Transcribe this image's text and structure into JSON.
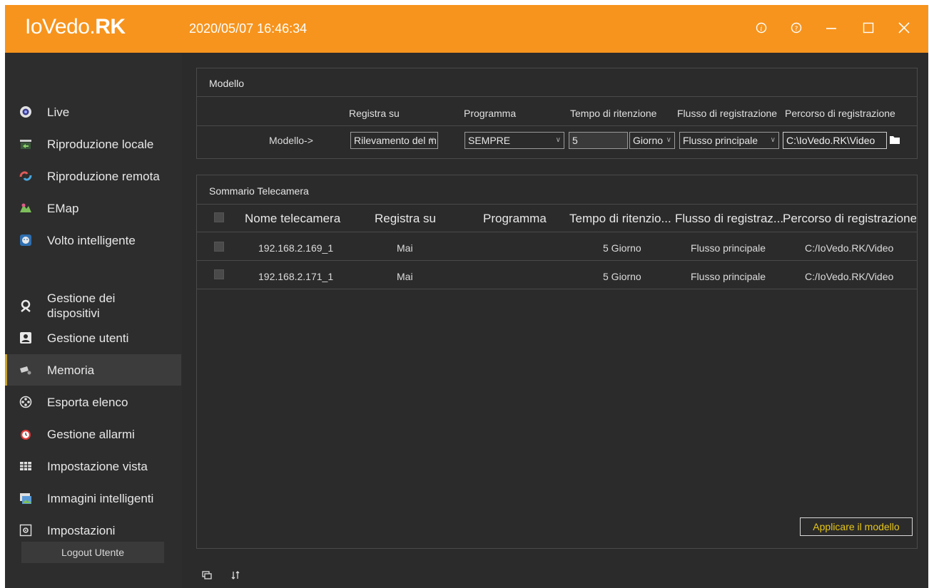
{
  "app": {
    "logo_light": "IoVedo.",
    "logo_bold": "RK",
    "datetime": "2020/05/07 16:46:34"
  },
  "titlebar_icons": [
    "info-icon",
    "help-icon",
    "minimize-icon",
    "maximize-icon",
    "close-icon"
  ],
  "sidebar": {
    "items": [
      {
        "label": "Live",
        "icon": "live-icon"
      },
      {
        "label": "Riproduzione locale",
        "icon": "local-playback-icon"
      },
      {
        "label": "Riproduzione remota",
        "icon": "remote-playback-icon"
      },
      {
        "label": "EMap",
        "icon": "emap-icon"
      },
      {
        "label": "Volto intelligente",
        "icon": "face-icon"
      },
      {
        "label": "Gestione dei dispositivi",
        "icon": "device-icon"
      },
      {
        "label": "Gestione utenti",
        "icon": "user-icon"
      },
      {
        "label": "Memoria",
        "icon": "storage-icon",
        "active": true
      },
      {
        "label": "Esporta elenco",
        "icon": "export-icon"
      },
      {
        "label": "Gestione allarmi",
        "icon": "alarm-icon"
      },
      {
        "label": "Impostazione vista",
        "icon": "view-grid-icon"
      },
      {
        "label": "Immagini intelligenti",
        "icon": "images-icon"
      },
      {
        "label": "Impostazioni",
        "icon": "settings-icon"
      }
    ],
    "logout_label": "Logout Utente"
  },
  "template_panel": {
    "title": "Modello",
    "headers": {
      "record_on": "Registra su",
      "schedule": "Programma",
      "retention": "Tempo di ritenzione",
      "stream": "Flusso di registrazione",
      "path": "Percorso di registrazione"
    },
    "row_label": "Modello->",
    "fields": {
      "record_on": "Rilevamento del m",
      "schedule": "SEMPRE",
      "retention_value": "5",
      "retention_unit": "Giorno",
      "stream": "Flusso principale",
      "path": "C:\\IoVedo.RK\\Video"
    }
  },
  "summary_panel": {
    "title": "Sommario Telecamera",
    "columns": [
      "Nome telecamera",
      "Registra su",
      "Programma",
      "Tempo di ritenzio...",
      "Flusso di registraz...",
      "Percorso di registrazione"
    ],
    "rows": [
      {
        "name": "192.168.2.169_1",
        "record_on": "Mai",
        "schedule": "",
        "retention": "5 Giorno",
        "stream": "Flusso principale",
        "path": "C:/IoVedo.RK/Video"
      },
      {
        "name": "192.168.2.171_1",
        "record_on": "Mai",
        "schedule": "",
        "retention": "5 Giorno",
        "stream": "Flusso principale",
        "path": "C:/IoVedo.RK/Video"
      }
    ],
    "apply_label": "Applicare il modello"
  },
  "colors": {
    "titlebar": "#f7941d",
    "background": "#2b2b2b",
    "apply_text": "#e6c619",
    "active_indicator": "#c9a227"
  }
}
